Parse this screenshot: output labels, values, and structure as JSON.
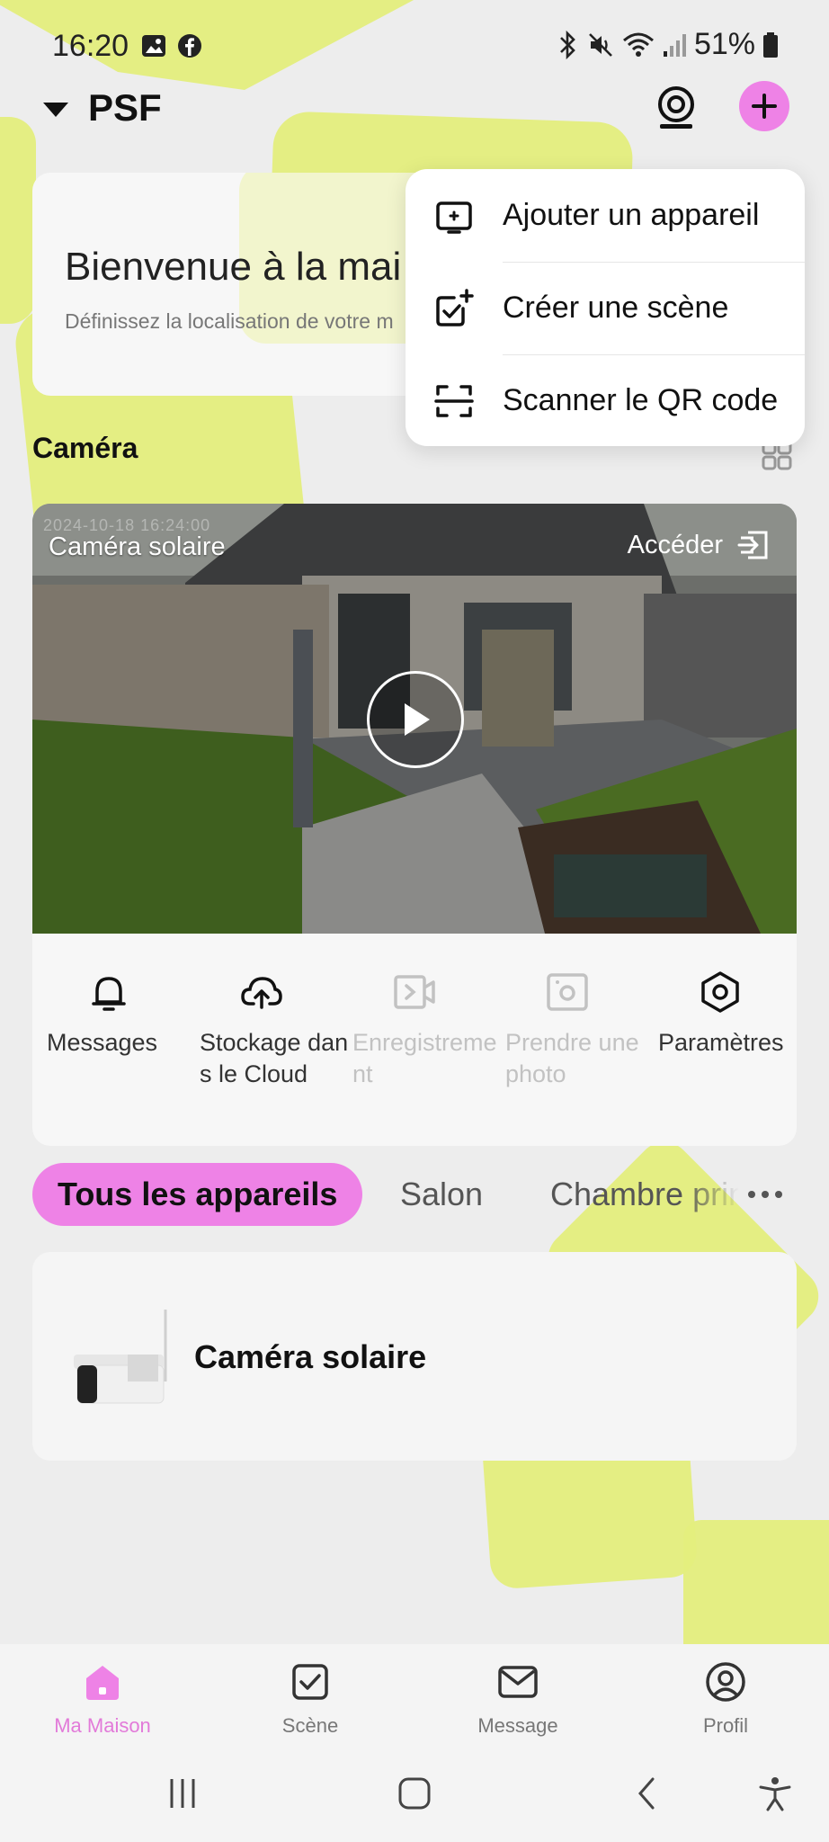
{
  "status_bar": {
    "time": "16:20",
    "battery": "51%",
    "left_icons": [
      "gallery-icon",
      "facebook-icon"
    ],
    "right_icons": [
      "bluetooth-icon",
      "mute-icon",
      "wifi-icon",
      "signal-icon",
      "battery-icon"
    ]
  },
  "header": {
    "home_name": "PSF",
    "icons": [
      "dropdown-caret-icon",
      "webcam-icon",
      "plus-icon"
    ]
  },
  "welcome": {
    "title": "Bienvenue à la mai",
    "subtitle": "Définissez la localisation de votre m"
  },
  "add_menu": {
    "items": [
      {
        "label": "Ajouter un appareil",
        "icon": "add-device-icon"
      },
      {
        "label": "Créer une scène",
        "icon": "create-scene-icon"
      },
      {
        "label": "Scanner le QR code",
        "icon": "qr-scan-icon"
      }
    ]
  },
  "camera_section": {
    "title": "Caméra",
    "view_icon": "grid-view-icon",
    "card": {
      "camera_name": "Caméra solaire",
      "timestamp": "2024-10-18 16:24:00",
      "access_label": "Accéder",
      "actions": [
        {
          "label": "Messages",
          "icon": "bell-icon",
          "enabled": true
        },
        {
          "label": "Stockage dans le Cloud",
          "icon": "cloud-upload-icon",
          "enabled": true
        },
        {
          "label": "Enregistrement",
          "icon": "record-video-icon",
          "enabled": false
        },
        {
          "label": "Prendre une photo",
          "icon": "photo-icon",
          "enabled": false
        },
        {
          "label": "Paramètres",
          "icon": "settings-hex-icon",
          "enabled": true
        }
      ]
    }
  },
  "room_tabs": {
    "items": [
      "Tous les appareils",
      "Salon",
      "Chambre principale"
    ],
    "active": 0
  },
  "devices": [
    {
      "name": "Caméra solaire"
    }
  ],
  "bottom_nav": {
    "items": [
      {
        "label": "Ma Maison",
        "icon": "home-icon",
        "active": true
      },
      {
        "label": "Scène",
        "icon": "scene-check-icon",
        "active": false
      },
      {
        "label": "Message",
        "icon": "envelope-icon",
        "active": false
      },
      {
        "label": "Profil",
        "icon": "profile-icon",
        "active": false
      }
    ]
  },
  "colors": {
    "accent_pink": "#ee82e6",
    "background_shape": "#e4ee7d",
    "background": "#ededed"
  }
}
